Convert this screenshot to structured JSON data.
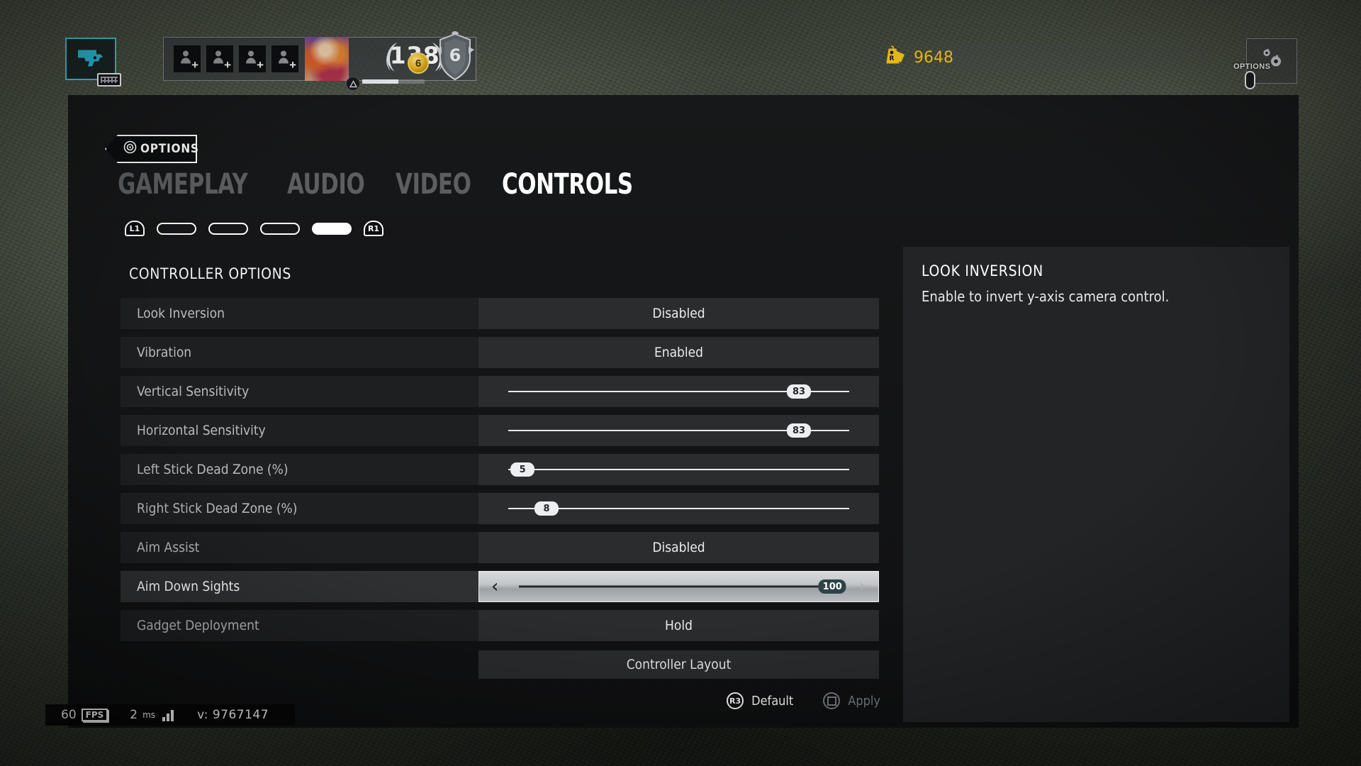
{
  "hud": {
    "weapon_icon": "pistol-icon",
    "input_badge": "keyboard-icon",
    "squad_slots": [
      "add-player-icon",
      "add-player-icon",
      "add-player-icon",
      "add-player-icon"
    ],
    "avatar": "player-avatar",
    "level": "138",
    "coin_label": "6",
    "rank_emblem": "r6-rank-emblem",
    "currency": "9648",
    "currency_icon": "renown-tag-icon",
    "options_label": "OPTIONS",
    "options_icon": "gears-icon"
  },
  "header": {
    "badge_label": "OPTIONS",
    "badge_icon": "circle-target-icon"
  },
  "tabs": [
    {
      "label": "GAMEPLAY",
      "active": false
    },
    {
      "label": "AUDIO",
      "active": false
    },
    {
      "label": "VIDEO",
      "active": false
    },
    {
      "label": "CONTROLS",
      "active": true
    }
  ],
  "pager": {
    "left_bumper": "L1",
    "right_bumper": "R1",
    "pills": [
      false,
      false,
      false,
      true
    ]
  },
  "section": {
    "title": "CONTROLLER OPTIONS"
  },
  "rows": [
    {
      "label": "Look Inversion",
      "type": "value",
      "value": "Disabled",
      "selected": false
    },
    {
      "label": "Vibration",
      "type": "value",
      "value": "Enabled",
      "selected": false
    },
    {
      "label": "Vertical Sensitivity",
      "type": "slider",
      "value": "83",
      "percent": 80,
      "selected": false
    },
    {
      "label": "Horizontal Sensitivity",
      "type": "slider",
      "value": "83",
      "percent": 80,
      "selected": false
    },
    {
      "label": "Left Stick Dead Zone (%)",
      "type": "slider",
      "value": "5",
      "percent": 4,
      "selected": false
    },
    {
      "label": "Right Stick Dead Zone (%)",
      "type": "slider",
      "value": "8",
      "percent": 10,
      "selected": false
    },
    {
      "label": "Aim Assist",
      "type": "value",
      "value": "Disabled",
      "selected": false
    },
    {
      "label": "Aim Down Sights",
      "type": "slider",
      "value": "100",
      "percent": 97,
      "selected": true
    },
    {
      "label": "Gadget Deployment",
      "type": "value",
      "value": "Hold",
      "selected": false
    }
  ],
  "layout_button": {
    "label": "Controller Layout"
  },
  "footer": {
    "default_button": "R3",
    "default_label": "Default",
    "apply_button": "square-button-icon",
    "apply_label": "Apply"
  },
  "info": {
    "title": "LOOK INVERSION",
    "description": "Enable to invert y-axis camera control."
  },
  "fps": {
    "value": "60",
    "unit": "FPS",
    "latency": "2",
    "latency_unit": "ms",
    "version": "v: 9767147"
  },
  "colors": {
    "accent_cyan": "#3fd0e8",
    "currency_gold": "#f2c31b",
    "selected_knob": "#2c4347",
    "panel_bg": "#171819",
    "row_label_bg": "#1e1f21",
    "row_value_bg": "#2a2c2e"
  }
}
